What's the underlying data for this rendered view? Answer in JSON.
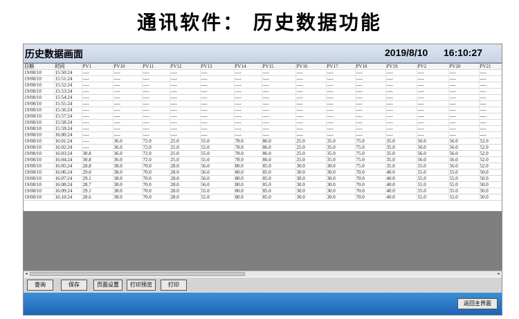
{
  "banner_title": "通讯软件：  历史数据功能",
  "window": {
    "title": "历史数据画面",
    "date": "2019/8/10",
    "time": "16:10:27"
  },
  "table": {
    "columns": [
      "日期",
      "时间",
      "PV1",
      "PV10",
      "PV11",
      "PV12",
      "PV13",
      "PV14",
      "PV15",
      "PV16",
      "PV17",
      "PV18",
      "PV19",
      "PV2",
      "PV20",
      "PV21"
    ],
    "rows": [
      [
        "19/08/10",
        "15:50:24",
        "----",
        "----",
        "----",
        "----",
        "----",
        "----",
        "----",
        "----",
        "----",
        "----",
        "----",
        "----",
        "----",
        "----"
      ],
      [
        "19/08/10",
        "15:51:24",
        "----",
        "----",
        "----",
        "----",
        "----",
        "----",
        "----",
        "----",
        "----",
        "----",
        "----",
        "----",
        "----",
        "----"
      ],
      [
        "19/08/10",
        "15:52:24",
        "----",
        "----",
        "----",
        "----",
        "----",
        "----",
        "----",
        "----",
        "----",
        "----",
        "----",
        "----",
        "----",
        "----"
      ],
      [
        "19/08/10",
        "15:53:24",
        "----",
        "----",
        "----",
        "----",
        "----",
        "----",
        "----",
        "----",
        "----",
        "----",
        "----",
        "----",
        "----",
        "----"
      ],
      [
        "19/08/10",
        "15:54:24",
        "----",
        "----",
        "----",
        "----",
        "----",
        "----",
        "----",
        "----",
        "----",
        "----",
        "----",
        "----",
        "----",
        "----"
      ],
      [
        "19/08/10",
        "15:55:24",
        "----",
        "----",
        "----",
        "----",
        "----",
        "----",
        "----",
        "----",
        "----",
        "----",
        "----",
        "----",
        "----",
        "----"
      ],
      [
        "19/08/10",
        "15:56:24",
        "----",
        "----",
        "----",
        "----",
        "----",
        "----",
        "----",
        "----",
        "----",
        "----",
        "----",
        "----",
        "----",
        "----"
      ],
      [
        "19/08/10",
        "15:57:24",
        "----",
        "----",
        "----",
        "----",
        "----",
        "----",
        "----",
        "----",
        "----",
        "----",
        "----",
        "----",
        "----",
        "----"
      ],
      [
        "19/08/10",
        "15:58:24",
        "----",
        "----",
        "----",
        "----",
        "----",
        "----",
        "----",
        "----",
        "----",
        "----",
        "----",
        "----",
        "----",
        "----"
      ],
      [
        "19/08/10",
        "15:59:24",
        "----",
        "----",
        "----",
        "----",
        "----",
        "----",
        "----",
        "----",
        "----",
        "----",
        "----",
        "----",
        "----",
        "----"
      ],
      [
        "19/08/10",
        "16:00:24",
        "----",
        "----",
        "----",
        "----",
        "----",
        "----",
        "----",
        "----",
        "----",
        "----",
        "----",
        "----",
        "----",
        "----"
      ],
      [
        "19/08/10",
        "16:01:24",
        "----",
        "36.0",
        "72.0",
        "25.0",
        "55.0",
        "78.0",
        "86.0",
        "25.0",
        "35.0",
        "75.0",
        "35.0",
        "56.0",
        "56.0",
        "52.0"
      ],
      [
        "19/08/10",
        "16:02:24",
        "----",
        "36.0",
        "72.0",
        "25.0",
        "55.0",
        "78.0",
        "86.0",
        "25.0",
        "35.0",
        "75.0",
        "35.0",
        "56.0",
        "56.0",
        "52.0"
      ],
      [
        "19/08/10",
        "16:03:24",
        "30.8",
        "36.0",
        "72.0",
        "25.0",
        "55.0",
        "78.0",
        "86.0",
        "25.0",
        "35.0",
        "75.0",
        "35.0",
        "56.0",
        "56.0",
        "52.0"
      ],
      [
        "19/08/10",
        "16:04:24",
        "30.8",
        "36.0",
        "72.0",
        "25.0",
        "55.0",
        "78.0",
        "86.0",
        "25.0",
        "35.0",
        "75.0",
        "35.0",
        "56.0",
        "56.0",
        "52.0"
      ],
      [
        "19/08/10",
        "16:05:24",
        "28.8",
        "38.0",
        "70.0",
        "28.0",
        "56.0",
        "80.0",
        "85.0",
        "30.0",
        "30.0",
        "75.0",
        "35.0",
        "55.0",
        "56.0",
        "52.0"
      ],
      [
        "19/08/10",
        "16:06:24",
        "29.0",
        "38.0",
        "70.0",
        "28.0",
        "56.0",
        "80.0",
        "85.0",
        "30.0",
        "30.0",
        "70.0",
        "40.0",
        "55.0",
        "55.0",
        "50.0"
      ],
      [
        "19/08/10",
        "16:07:24",
        "29.1",
        "38.0",
        "70.0",
        "28.0",
        "56.0",
        "80.0",
        "85.0",
        "30.0",
        "30.0",
        "70.0",
        "40.0",
        "55.0",
        "55.0",
        "50.0"
      ],
      [
        "19/08/10",
        "16:08:24",
        "28.7",
        "38.0",
        "70.0",
        "28.0",
        "56.0",
        "80.0",
        "85.0",
        "30.0",
        "30.0",
        "70.0",
        "40.0",
        "55.0",
        "55.0",
        "50.0"
      ],
      [
        "19/08/10",
        "16:09:24",
        "29.1",
        "38.0",
        "70.0",
        "28.0",
        "55.0",
        "80.0",
        "85.0",
        "30.0",
        "30.0",
        "70.0",
        "40.0",
        "55.0",
        "55.0",
        "50.0"
      ],
      [
        "19/08/10",
        "16:10:24",
        "28.6",
        "38.0",
        "70.0",
        "28.0",
        "55.0",
        "80.0",
        "85.0",
        "30.0",
        "30.0",
        "70.0",
        "40.0",
        "55.0",
        "55.0",
        "50.0"
      ]
    ]
  },
  "toolbar": {
    "query_label": "查询",
    "save_label": "保存",
    "page_setup_label": "页面设置",
    "print_preview_label": "打印预览",
    "print_label": "打印"
  },
  "footer": {
    "return_main_label": "返回主界面"
  },
  "colors": {
    "footer_bar": "#1d64b4",
    "titlebar": "#c6d3e8",
    "grid_empty_area": "#7f7f7f"
  }
}
